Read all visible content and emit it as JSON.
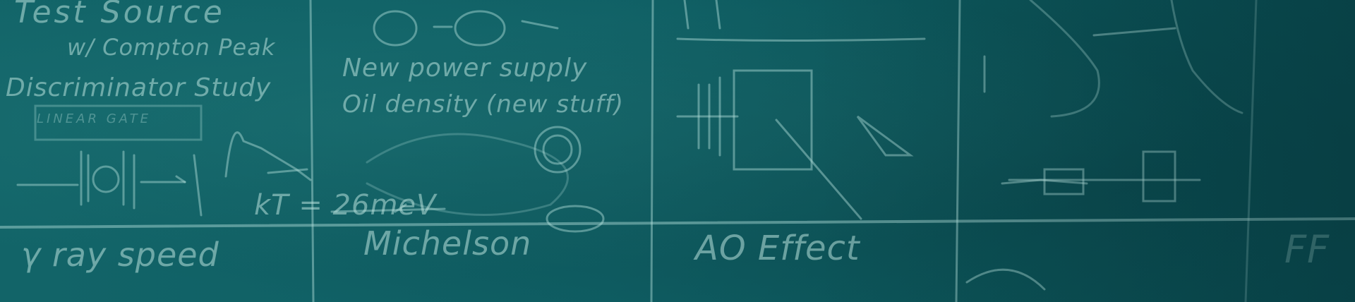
{
  "image": {
    "description_labels": {
      "line1": "Test Source",
      "line2": "w/ Compton Peak",
      "line3": "Discriminator Study",
      "line4": "LINEAR GATE",
      "line5": "New power supply",
      "line6": "Oil density (new stuff)",
      "line7": "kT = 26meV",
      "line8": "γ ray speed",
      "line9": "Michelson",
      "line10": "AO Effect",
      "line11": "FF"
    }
  }
}
